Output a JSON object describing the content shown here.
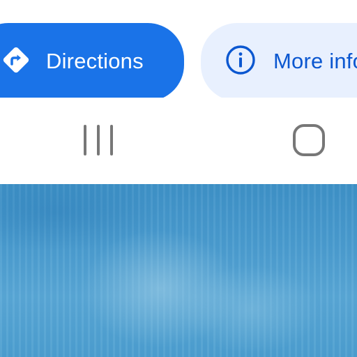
{
  "app": {
    "accent_color": "#1a73e8",
    "secondary_chip_color": "#e8f0fe",
    "secondary_text_color": "#0b57d0"
  },
  "actions": {
    "directions": {
      "label": "Directions",
      "icon": "directions-icon"
    },
    "more_info": {
      "label": "More info",
      "icon": "info-icon"
    }
  },
  "navigation_bar": {
    "recents": {
      "icon": "recents-icon"
    },
    "home": {
      "icon": "home-icon"
    }
  },
  "wallpaper": {
    "description_color": "#4b9ccf"
  }
}
